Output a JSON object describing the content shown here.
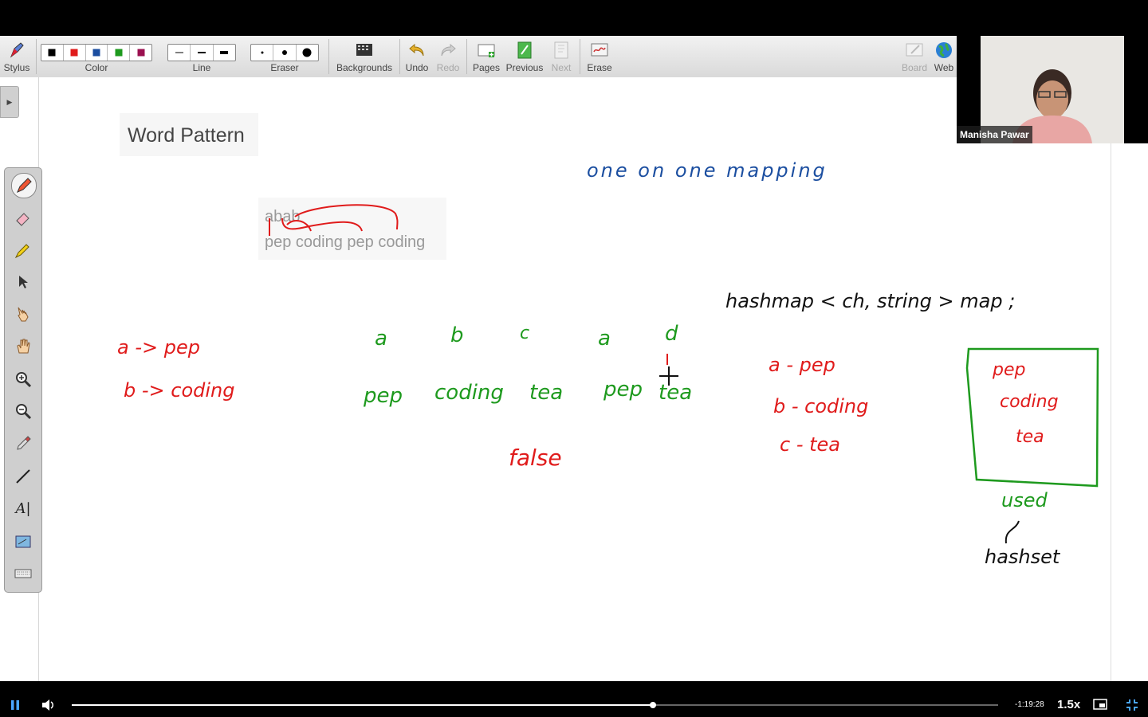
{
  "toolbar": {
    "stylus": "Stylus",
    "color": "Color",
    "line": "Line",
    "eraser": "Eraser",
    "backgrounds": "Backgrounds",
    "undo": "Undo",
    "redo": "Redo",
    "pages": "Pages",
    "previous": "Previous",
    "next": "Next",
    "erase": "Erase",
    "board": "Board",
    "web": "Web",
    "colors": [
      "#000000",
      "#e01b1b",
      "#1b4ea0",
      "#1e9a1e",
      "#9b1050"
    ]
  },
  "board": {
    "title": "Word Pattern",
    "example_pattern": "abab",
    "example_words": "pep coding pep coding",
    "ink": {
      "mapping_note": "one on one mapping",
      "map_decl": "hashmap < ch, string > map ;",
      "map_left_1": "a -> pep",
      "map_left_2": "b -> coding",
      "pattern_letters": [
        "a",
        "b",
        "c",
        "a",
        "d"
      ],
      "pattern_words": [
        "pep",
        "coding",
        "tea",
        "pep",
        "tea"
      ],
      "result": "false",
      "map_right_1": "a - pep",
      "map_right_2": "b - coding",
      "map_right_3": "c - tea",
      "set_items": [
        "pep",
        "coding",
        "tea"
      ],
      "set_label": "used",
      "set_type": "hashset"
    }
  },
  "webcam": {
    "name": "Manisha Pawar"
  },
  "player": {
    "time_remaining": "-1:19:28",
    "speed": "1.5x",
    "progress": 0.627
  }
}
